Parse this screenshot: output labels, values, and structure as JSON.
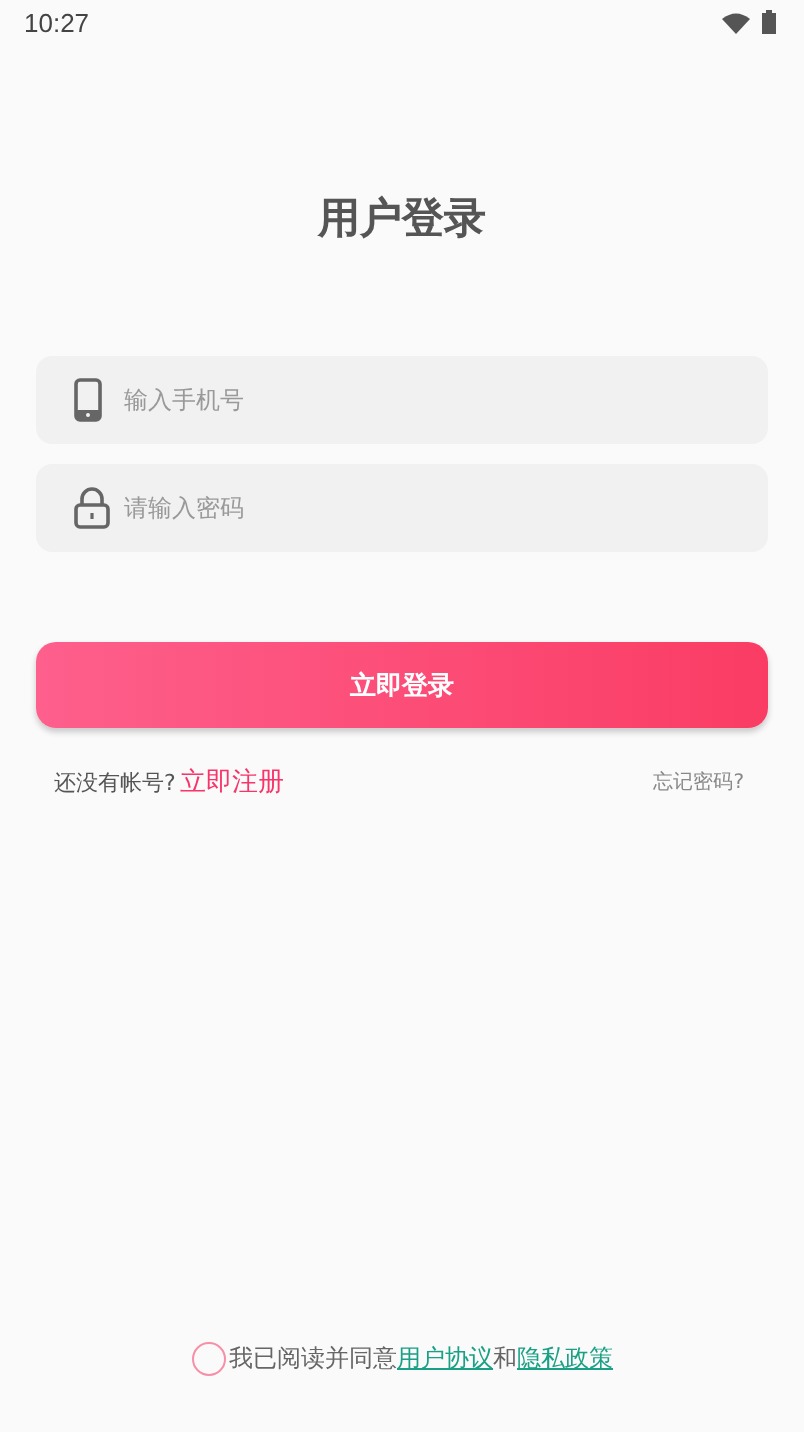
{
  "status_bar": {
    "time": "10:27"
  },
  "title": "用户登录",
  "fields": [
    {
      "kind": "phone",
      "placeholder": "输入手机号"
    },
    {
      "kind": "password",
      "placeholder": "请输入密码"
    }
  ],
  "login_button": "立即登录",
  "register": {
    "prompt": "还没有帐号?",
    "link": "立即注册"
  },
  "forgot_link": "忘记密码?",
  "agreement": {
    "checked": false,
    "prefix": "我已阅读并同意",
    "terms_link": "用户协议",
    "joiner": "和",
    "privacy_link": "隐私政策"
  }
}
